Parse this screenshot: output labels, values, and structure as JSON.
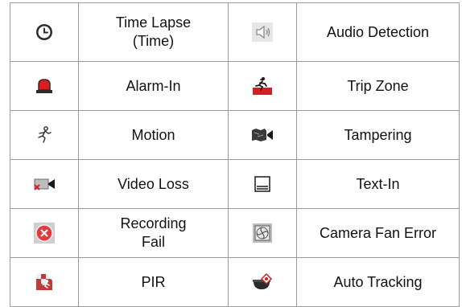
{
  "events": [
    {
      "left": {
        "icon": "clock-icon",
        "label": "Time Lapse (Time)"
      },
      "right": {
        "icon": "speaker-icon",
        "label": "Audio Detection"
      }
    },
    {
      "left": {
        "icon": "alarm-light-icon",
        "label": "Alarm-In"
      },
      "right": {
        "icon": "trip-zone-icon",
        "label": "Trip Zone"
      }
    },
    {
      "left": {
        "icon": "running-person-icon",
        "label": "Motion"
      },
      "right": {
        "icon": "tampered-camera-icon",
        "label": "Tampering"
      }
    },
    {
      "left": {
        "icon": "video-loss-camera-icon",
        "label": "Video Loss"
      },
      "right": {
        "icon": "text-document-icon",
        "label": "Text-In"
      }
    },
    {
      "left": {
        "icon": "record-fail-icon",
        "label": "Recording Fail"
      },
      "right": {
        "icon": "fan-icon",
        "label": "Camera Fan Error"
      }
    },
    {
      "left": {
        "icon": "pir-sensor-icon",
        "label": "PIR"
      },
      "right": {
        "icon": "ptz-dome-icon",
        "label": "Auto Tracking"
      }
    }
  ],
  "colors": {
    "alarm_red": "#d81e1e",
    "record_fail_red": "#e23b3b",
    "border": "#9a9a9a"
  }
}
